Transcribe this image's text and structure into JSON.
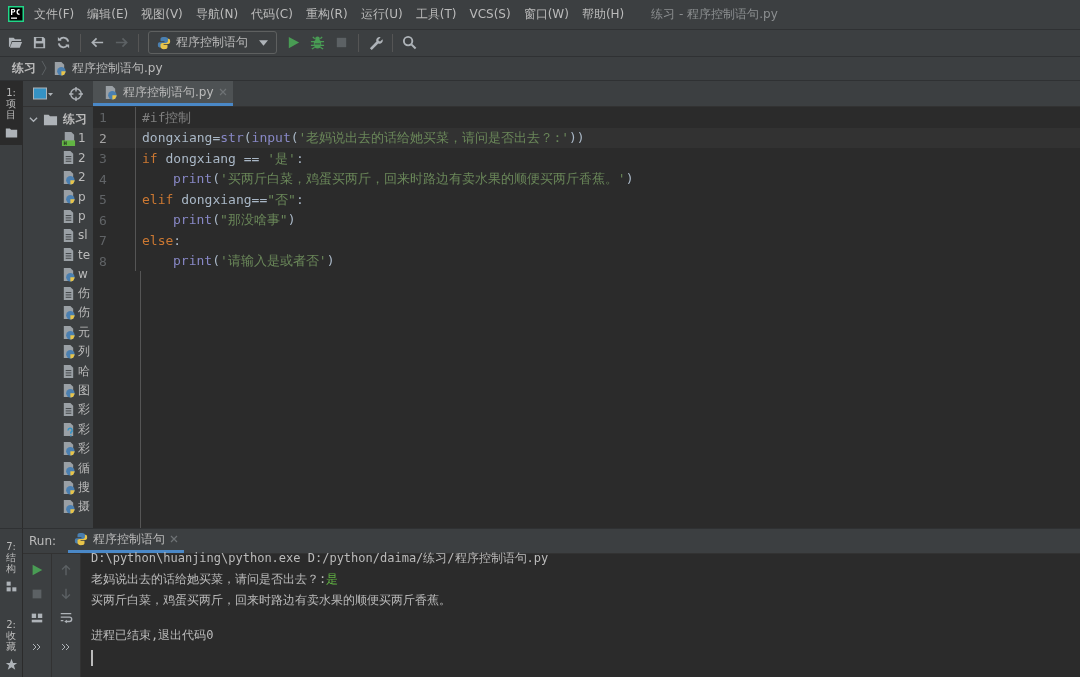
{
  "menu_bar": {
    "items": [
      "文件(F)",
      "编辑(E)",
      "视图(V)",
      "导航(N)",
      "代码(C)",
      "重构(R)",
      "运行(U)",
      "工具(T)",
      "VCS(S)",
      "窗口(W)",
      "帮助(H)"
    ],
    "title": "练习 - 程序控制语句.py"
  },
  "toolbar": {
    "run_config": "程序控制语句"
  },
  "breadcrumb": [
    "练习",
    "程序控制语句.py"
  ],
  "left_strip": [
    {
      "label": "1: 项目",
      "selected": true
    }
  ],
  "project": {
    "root": {
      "label": "练习",
      "expanded": true,
      "children": [
        {
          "label": "1",
          "kind": "html"
        },
        {
          "label": "2",
          "kind": "text"
        },
        {
          "label": "2",
          "kind": "python"
        },
        {
          "label": "p",
          "kind": "python"
        },
        {
          "label": "p",
          "kind": "text"
        },
        {
          "label": "sl",
          "kind": "text"
        },
        {
          "label": "te",
          "kind": "text"
        },
        {
          "label": "w",
          "kind": "python"
        },
        {
          "label": "伤",
          "kind": "text"
        },
        {
          "label": "伤",
          "kind": "python"
        },
        {
          "label": "元",
          "kind": "python"
        },
        {
          "label": "列",
          "kind": "python"
        },
        {
          "label": "哈",
          "kind": "text"
        },
        {
          "label": "图",
          "kind": "python"
        },
        {
          "label": "彩",
          "kind": "text"
        },
        {
          "label": "彩",
          "kind": "unknown"
        },
        {
          "label": "彩",
          "kind": "python"
        },
        {
          "label": "循",
          "kind": "python"
        },
        {
          "label": "搜",
          "kind": "python"
        },
        {
          "label": "摄",
          "kind": "python"
        }
      ]
    }
  },
  "editor": {
    "tabs": [
      {
        "label": "程序控制语句.py",
        "selected": true
      }
    ],
    "lines": [
      {
        "number": "1",
        "current": false,
        "tokens": [
          {
            "kind": "comment",
            "text": "#if控制"
          }
        ]
      },
      {
        "number": "2",
        "current": true,
        "tokens": [
          {
            "kind": "name",
            "text": "dongxiang="
          },
          {
            "kind": "builtin",
            "text": "str"
          },
          {
            "kind": "name",
            "text": "("
          },
          {
            "kind": "builtin",
            "text": "input"
          },
          {
            "kind": "name",
            "text": "("
          },
          {
            "kind": "string",
            "text": "'老妈说出去的话给她买菜，请问是否出去？:'"
          },
          {
            "kind": "name",
            "text": "))"
          }
        ]
      },
      {
        "number": "3",
        "current": false,
        "tokens": [
          {
            "kind": "keyword",
            "text": "if "
          },
          {
            "kind": "name",
            "text": "dongxiang == "
          },
          {
            "kind": "string",
            "text": "'是'"
          },
          {
            "kind": "name",
            "text": ":"
          }
        ]
      },
      {
        "number": "4",
        "current": false,
        "indented": true,
        "tokens": [
          {
            "kind": "builtin",
            "text": "print"
          },
          {
            "kind": "name",
            "text": "("
          },
          {
            "kind": "string",
            "text": "'买两斤白菜，鸡蛋买两斤，回来时路边有卖水果的顺便买两斤香蕉。'"
          },
          {
            "kind": "name",
            "text": ")"
          }
        ]
      },
      {
        "number": "5",
        "current": false,
        "tokens": [
          {
            "kind": "keyword",
            "text": "elif "
          },
          {
            "kind": "name",
            "text": "dongxiang=="
          },
          {
            "kind": "string",
            "text": "\"否\""
          },
          {
            "kind": "name",
            "text": ":"
          }
        ]
      },
      {
        "number": "6",
        "current": false,
        "indented": true,
        "tokens": [
          {
            "kind": "builtin",
            "text": "print"
          },
          {
            "kind": "name",
            "text": "("
          },
          {
            "kind": "string",
            "text": "\"那没啥事\""
          },
          {
            "kind": "name",
            "text": ")"
          }
        ]
      },
      {
        "number": "7",
        "current": false,
        "tokens": [
          {
            "kind": "keyword",
            "text": "else"
          },
          {
            "kind": "name",
            "text": ":"
          }
        ]
      },
      {
        "number": "8",
        "current": false,
        "indented": true,
        "tokens": [
          {
            "kind": "builtin",
            "text": "print"
          },
          {
            "kind": "name",
            "text": "("
          },
          {
            "kind": "string",
            "text": "'请输入是或者否'"
          },
          {
            "kind": "name",
            "text": ")"
          }
        ]
      }
    ]
  },
  "run": {
    "label": "Run:",
    "tabs": [
      {
        "label": "程序控制语句",
        "selected": true
      }
    ],
    "output": [
      {
        "kind": "plain",
        "text": "D:\\python\\huanjing\\python.exe D:/python/daima/练习/程序控制语句.py"
      },
      {
        "kind": "plain",
        "text": "老妈说出去的话给她买菜，请问是否出去？:",
        "input": "是"
      },
      {
        "kind": "plain",
        "text": "买两斤白菜，鸡蛋买两斤，回来时路边有卖水果的顺便买两斤香蕉。"
      },
      {
        "kind": "exit",
        "text": "进程已结束,退出代码0"
      }
    ]
  },
  "bottom_strip": [
    {
      "label": "7: 结构",
      "selected": false
    },
    {
      "label": "2: 收藏",
      "selected": false
    }
  ]
}
